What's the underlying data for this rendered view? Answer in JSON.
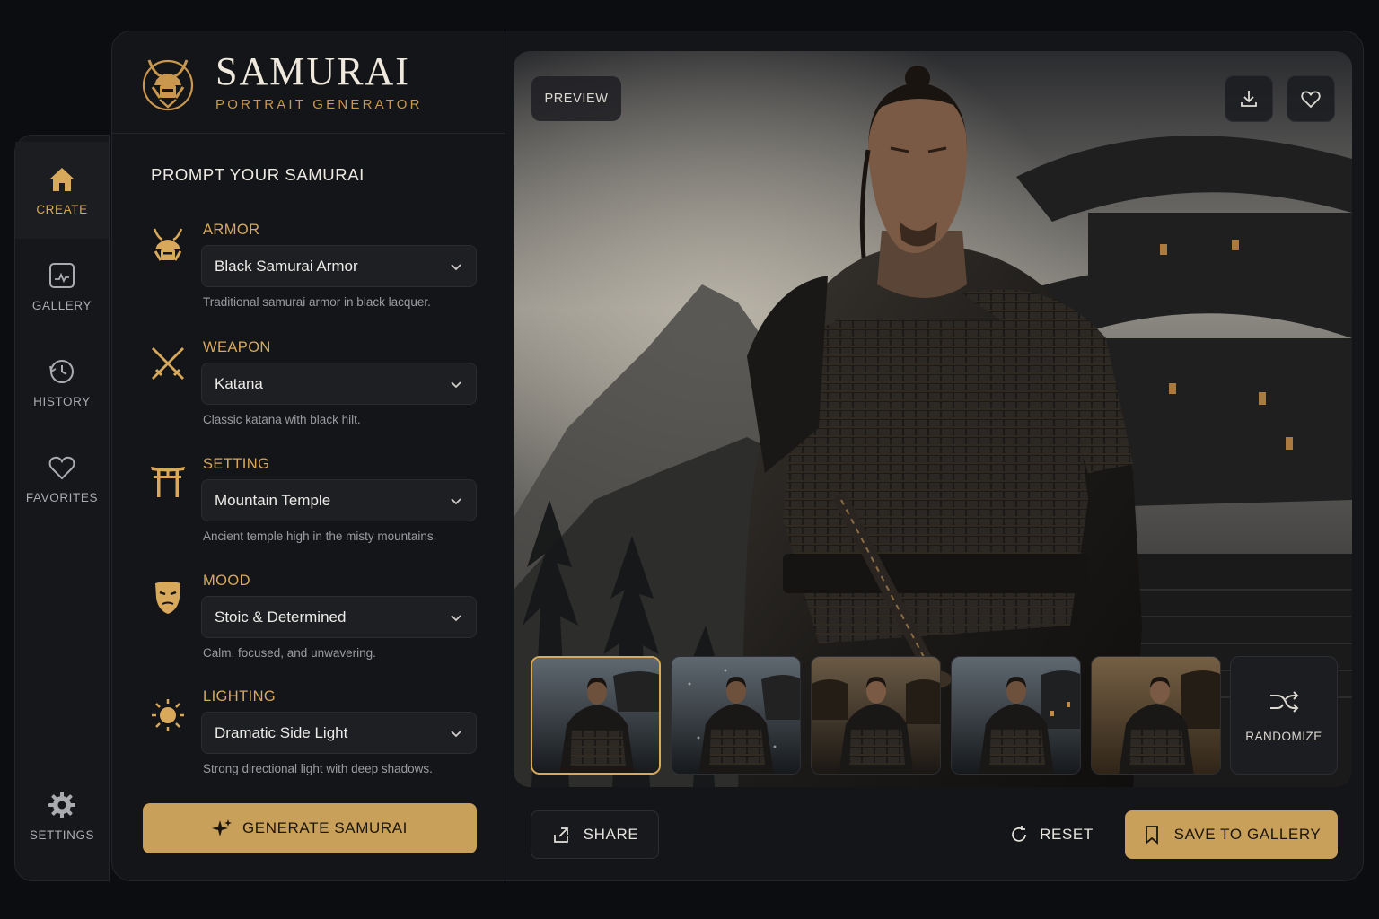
{
  "app": {
    "title": "SAMURAI",
    "subtitle": "PORTRAIT GENERATOR",
    "logo_icon": "samurai-helmet-logo"
  },
  "nav": {
    "items": [
      {
        "label": "CREATE",
        "icon": "home-icon",
        "active": true
      },
      {
        "label": "GALLERY",
        "icon": "gallery-icon",
        "active": false
      },
      {
        "label": "HISTORY",
        "icon": "history-icon",
        "active": false
      },
      {
        "label": "FAVORITES",
        "icon": "heart-icon",
        "active": false
      }
    ],
    "settings_label": "SETTINGS"
  },
  "prompt": {
    "heading": "PROMPT YOUR SAMURAI",
    "fields": [
      {
        "label": "ARMOR",
        "value": "Black Samurai Armor",
        "description": "Traditional samurai armor in black lacquer.",
        "icon": "samurai-helmet-icon"
      },
      {
        "label": "WEAPON",
        "value": "Katana",
        "description": "Classic katana with black hilt.",
        "icon": "crossed-swords-icon"
      },
      {
        "label": "SETTING",
        "value": "Mountain Temple",
        "description": "Ancient temple high in the misty mountains.",
        "icon": "torii-gate-icon"
      },
      {
        "label": "MOOD",
        "value": "Stoic & Determined",
        "description": "Calm, focused, and unwavering.",
        "icon": "mask-icon"
      },
      {
        "label": "LIGHTING",
        "value": "Dramatic Side Light",
        "description": "Strong directional light with deep shadows.",
        "icon": "sun-icon"
      }
    ],
    "generate_label": "GENERATE SAMURAI"
  },
  "preview": {
    "tag": "PREVIEW",
    "thumbnail_count": 5,
    "selected_thumbnail": 1,
    "randomize_label": "RANDOMIZE"
  },
  "actions": {
    "share_label": "SHARE",
    "reset_label": "RESET",
    "save_label": "SAVE TO GALLERY"
  },
  "colors": {
    "accent": "#c9a05a",
    "background": "#0c0d10",
    "panel": "#141518"
  }
}
